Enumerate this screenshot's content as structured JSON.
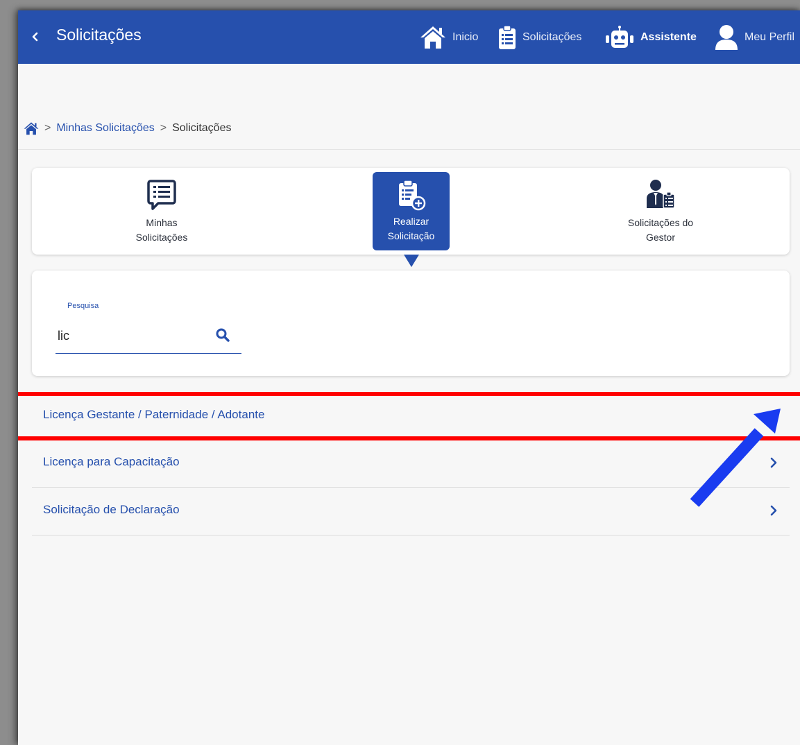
{
  "header": {
    "title": "Solicitações",
    "back_icon": "chevron-left-icon",
    "nav": [
      {
        "label": "Inicio",
        "icon": "home-icon"
      },
      {
        "label": "Solicitações",
        "icon": "clipboard-list-icon"
      },
      {
        "label": "Assistente",
        "icon": "robot-icon"
      },
      {
        "label": "Meu Perfil",
        "icon": "user-icon"
      }
    ]
  },
  "breadcrumb": {
    "home_icon": "home-icon",
    "items": [
      "Minhas Solicitações",
      "Solicitações"
    ]
  },
  "tabs": [
    {
      "line1": "Minhas",
      "line2": "Solicitações",
      "icon": "list-document-icon",
      "active": false
    },
    {
      "line1": "Realizar",
      "line2": "Solicitação",
      "icon": "clipboard-plus-icon",
      "active": true
    },
    {
      "line1": "Solicitações do",
      "line2": "Gestor",
      "icon": "manager-clipboard-icon",
      "active": false
    }
  ],
  "search": {
    "label": "Pesquisa",
    "value": "lic",
    "icon": "search-icon"
  },
  "results": [
    {
      "label": "Licença Gestante / Paternidade / Adotante"
    },
    {
      "label": "Licença para Capacitação"
    },
    {
      "label": "Solicitação de Declaração"
    }
  ],
  "colors": {
    "brand": "#2650ad",
    "highlight": "#ff0000",
    "arrow": "#1a3cf0",
    "background": "#f7f7f7"
  }
}
